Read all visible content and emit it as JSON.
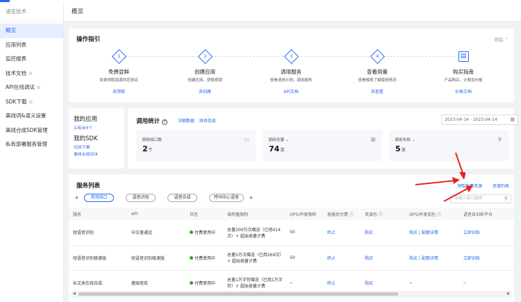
{
  "sidebar": {
    "title": "语音技术",
    "items": [
      {
        "label": "概览",
        "active": true,
        "link": false
      },
      {
        "label": "应用列表",
        "link": false
      },
      {
        "label": "监控报表",
        "link": false
      },
      {
        "label": "技术文档",
        "link": true
      },
      {
        "label": "API在线调试",
        "link": true
      },
      {
        "label": "SDK下载",
        "link": true
      },
      {
        "label": "离线词&语义设置",
        "link": false
      },
      {
        "label": "离线合成SDK管理",
        "link": false
      },
      {
        "label": "私有部署服务管理",
        "link": false
      }
    ]
  },
  "page": {
    "title": "概览"
  },
  "guide": {
    "title": "操作指引",
    "collapse": "收起",
    "steps": [
      {
        "num": "1",
        "name": "免费尝鲜",
        "desc": "免费领取资源供您测试",
        "link": "去领取"
      },
      {
        "num": "2",
        "name": "创建应用",
        "desc": "创建应用，获取密钥",
        "link": "去创建"
      },
      {
        "num": "3",
        "name": "调用服务",
        "desc": "查看请求示例，调用服务",
        "link": "API文档"
      },
      {
        "num": "4",
        "name": "查看用量",
        "desc": "查看报表了解使用情况",
        "link": "去查看"
      },
      {
        "num": "",
        "name": "购买指南",
        "desc": "产品购买，计费及价格",
        "link": "价格文档"
      }
    ]
  },
  "myapps": {
    "title": "我的应用",
    "count": "公有云4个",
    "sdk_title": "我的SDK",
    "sdk_links": [
      "SDK下载",
      "离线合成SDK"
    ]
  },
  "stats": {
    "title": "调用统计",
    "links": [
      "详细数据",
      "财务信息"
    ],
    "date_range": "2023-04-14 - 2023-04-14",
    "boxes": [
      {
        "label": "调用接口数",
        "value": "2",
        "unit": "个",
        "icon": "table-icon"
      },
      {
        "label": "调用总量",
        "value": "74",
        "unit": "次",
        "icon": "grid-icon"
      },
      {
        "label": "调用失败",
        "value": "5",
        "unit": "次",
        "icon": "crown-icon"
      }
    ]
  },
  "services": {
    "title": "服务列表",
    "links": [
      "领取免费资源",
      "资源列表"
    ],
    "tabs": [
      "常用接口",
      "语音识别",
      "语音合成",
      "呼叫中心语音"
    ],
    "search_placeholder": "请输入接口服务",
    "columns": [
      "服务",
      "API",
      "状态",
      "调用量限制",
      "QPS/并发限制",
      "按量后付费",
      "资源包",
      "QPS/并发加包",
      "语音自训练平台"
    ],
    "rows": [
      {
        "service": "短语音识别",
        "api": "中文普通话",
        "status": "付费使用中",
        "limit": "总量200万次赠送（已用414次）+ 超出按量计费",
        "qps": "50",
        "postpay": "终止",
        "pkg": "购买",
        "qpsadd": "购买 | 配额详情",
        "train": "立即训练"
      },
      {
        "service": "短语音识别极速版",
        "api": "短语音识别极速版",
        "status": "付费使用中",
        "limit": "总量5万次赠送（已用269次）+ 超出按量计费",
        "qps": "50",
        "postpay": "终止",
        "pkg": "购买",
        "qpsadd": "购买 | 配额详情",
        "train": "立即训练"
      },
      {
        "service": "长文本在线合成",
        "api": "基础音库",
        "status": "付费使用中",
        "limit": "总量1万字符赠送（已用1万字符）+ 超出按量计费",
        "qps": "--",
        "postpay": "终止",
        "pkg": "购买",
        "qpsadd": "--",
        "train": "--"
      }
    ]
  },
  "colors": {
    "accent": "#2468f2",
    "status_ok": "#2ea121",
    "annotation": "#e8231a"
  }
}
